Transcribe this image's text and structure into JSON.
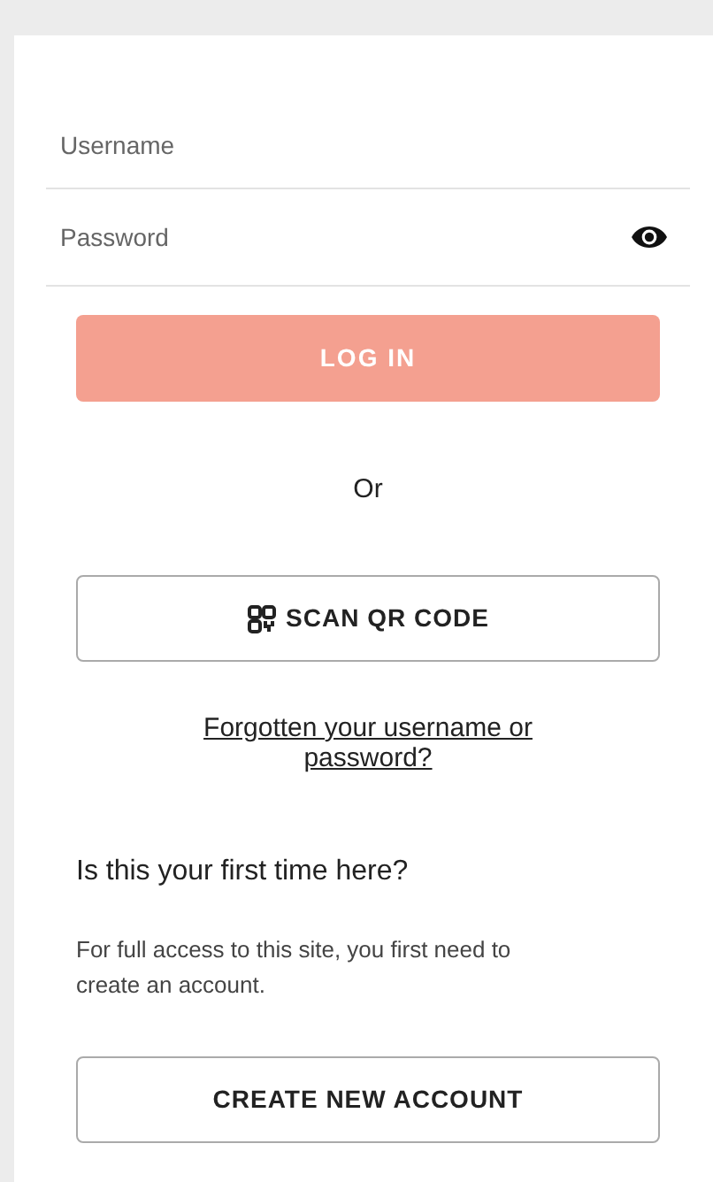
{
  "fields": [
    {
      "placeholder": "Username",
      "kind": "text"
    },
    {
      "placeholder": "Password",
      "kind": "password"
    }
  ],
  "login_button": {
    "label": "LOG IN",
    "disabled": true
  },
  "divider_text": "Or",
  "qr_button": {
    "label": "SCAN QR CODE"
  },
  "forgot_link": "Forgotten your username or password?",
  "signup": {
    "heading": "Is this your first time here?",
    "text": "For full access to this site, you first need to create an account.",
    "button": "CREATE NEW ACCOUNT"
  }
}
